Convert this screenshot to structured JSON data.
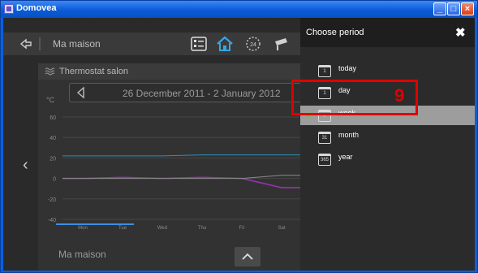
{
  "window": {
    "title": "Domovea"
  },
  "topbar": {
    "breadcrumb": "Ma maison"
  },
  "panel": {
    "title": "Thermostat salon",
    "unit": "°C",
    "date_range": "26 December 2011 - 2 January 2012",
    "footer_label": "Ma maison"
  },
  "chart_data": {
    "type": "line",
    "ylabel": "°C",
    "yticks": [
      "60",
      "40",
      "20",
      "0",
      "-20",
      "-40"
    ],
    "ylim": [
      -40,
      60
    ],
    "categories": [
      "Mon",
      "Tue",
      "Wed",
      "Thu",
      "Fri",
      "Sat"
    ],
    "grid": true,
    "series": [
      {
        "color": "#2d8fb8",
        "values": [
          22,
          22,
          22,
          23,
          23,
          23
        ]
      },
      {
        "color": "#9a2fb0",
        "values": [
          0,
          1,
          0,
          1,
          0,
          -9
        ]
      },
      {
        "color": "#8a8a8a",
        "values": [
          0,
          0,
          0,
          0,
          0,
          3
        ]
      }
    ]
  },
  "side_panel": {
    "title": "Choose period",
    "items": [
      {
        "icon_text": "1",
        "label": "today",
        "selected": false
      },
      {
        "icon_text": "1",
        "label": "day",
        "selected": false
      },
      {
        "icon_text": "7",
        "label": "week",
        "selected": true
      },
      {
        "icon_text": "31",
        "label": "month",
        "selected": false
      },
      {
        "icon_text": "365",
        "label": "year",
        "selected": false
      }
    ]
  },
  "annotation": {
    "number": "9",
    "color": "#e00000"
  }
}
